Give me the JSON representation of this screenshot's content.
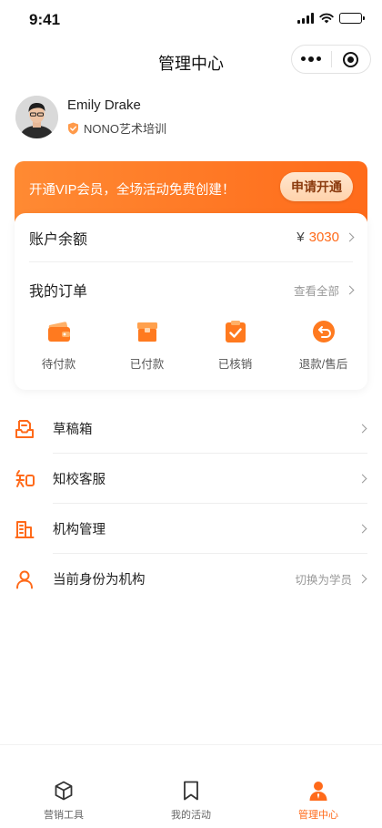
{
  "status_bar": {
    "time": "9:41"
  },
  "nav": {
    "title": "管理中心"
  },
  "profile": {
    "name": "Emily Drake",
    "org": "NONO艺术培训"
  },
  "vip": {
    "text": "开通VIP会员，全场活动免费创建！",
    "button": "申请开通"
  },
  "balance": {
    "label": "账户余额",
    "currency": "¥",
    "amount": "3030"
  },
  "orders": {
    "title": "我的订单",
    "view_all": "查看全部",
    "items": [
      {
        "label": "待付款",
        "icon": "wallet-icon"
      },
      {
        "label": "已付款",
        "icon": "box-icon"
      },
      {
        "label": "已核销",
        "icon": "clipboard-check-icon"
      },
      {
        "label": "退款/售后",
        "icon": "return-icon"
      }
    ]
  },
  "menu": [
    {
      "label": "草稿箱",
      "icon": "drafts-icon",
      "right": ""
    },
    {
      "label": "知校客服",
      "icon": "zhi-service-icon",
      "right": ""
    },
    {
      "label": "机构管理",
      "icon": "building-icon",
      "right": ""
    },
    {
      "label": "当前身份为机构",
      "icon": "user-icon",
      "right": "切换为学员"
    }
  ],
  "tabs": [
    {
      "label": "营销工具",
      "icon": "cube-icon",
      "active": false
    },
    {
      "label": "我的活动",
      "icon": "bookmark-icon",
      "active": false
    },
    {
      "label": "管理中心",
      "icon": "person-icon",
      "active": true
    }
  ],
  "colors": {
    "accent": "#ff6a1a",
    "vip_gradient_start": "#ff8a33",
    "vip_gradient_end": "#ff6b1a"
  }
}
